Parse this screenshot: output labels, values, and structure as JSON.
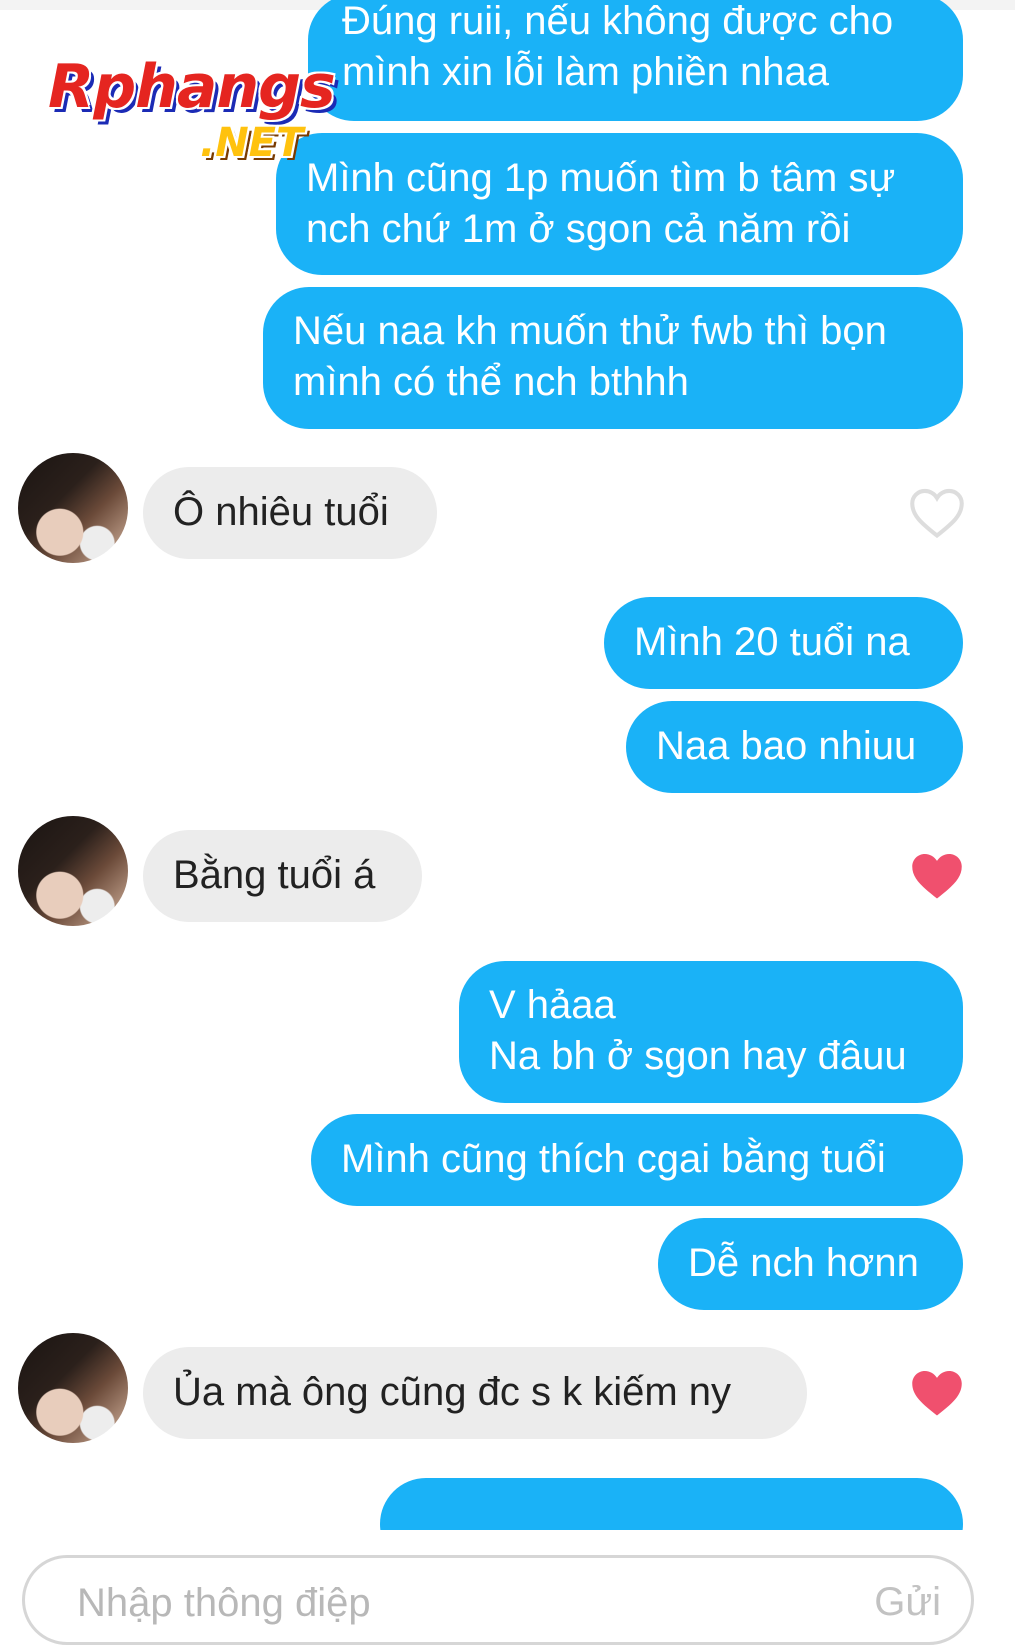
{
  "watermark": {
    "main": "Rphangs",
    "sub": ".NET"
  },
  "messages": [
    {
      "id": "m1",
      "side": "out",
      "text": "Đúng ruii, nếu không được cho\nmình xin lỗi làm phiền nhaa"
    },
    {
      "id": "m2",
      "side": "out",
      "text": "Mình cũng 1p muốn tìm b tâm sự\nnch chứ 1m ở sgon cả năm rồi"
    },
    {
      "id": "m3",
      "side": "out",
      "text": "Nếu naa kh muốn thử fwb thì bọn\nmình có thể nch bthhh"
    },
    {
      "id": "m4",
      "side": "in",
      "text": "Ô nhiêu tuổi",
      "liked": false
    },
    {
      "id": "m5",
      "side": "out",
      "text": "Mình 20 tuổi na"
    },
    {
      "id": "m6",
      "side": "out",
      "text": "Naa bao nhiuu"
    },
    {
      "id": "m7",
      "side": "in",
      "text": "Bằng tuổi á",
      "liked": true
    },
    {
      "id": "m8",
      "side": "out",
      "text": "V hảaa\nNa bh ở sgon hay đâuu"
    },
    {
      "id": "m9",
      "side": "out",
      "text": "Mình cũng thích cgai bằng tuổi"
    },
    {
      "id": "m10",
      "side": "out",
      "text": "Dễ nch hơnn"
    },
    {
      "id": "m11",
      "side": "in",
      "text": "Ủa mà ông cũng đc s k kiếm ny",
      "liked": true
    }
  ],
  "composer": {
    "placeholder": "Nhập thông điệp",
    "send_label": "Gửi"
  },
  "colors": {
    "outgoing": "#1ab2f7",
    "incoming": "#ececec",
    "heart": "#f0506e",
    "heart_empty": "#dddddd"
  }
}
